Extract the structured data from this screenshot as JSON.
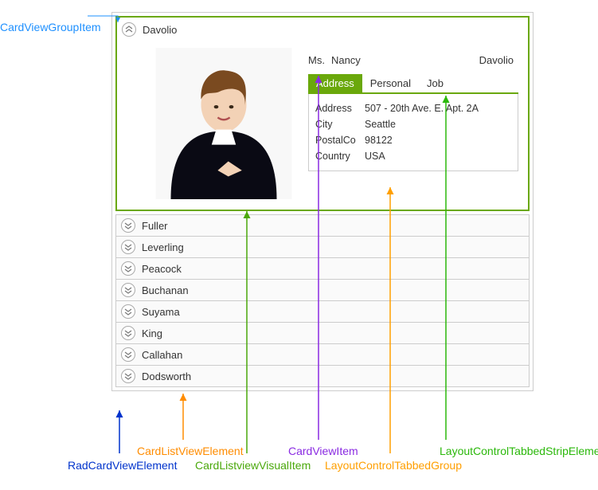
{
  "callouts": {
    "top_left": "CardViewGroupItem",
    "bottom": {
      "rad": "RadCardViewElement",
      "cardlist": "CardListViewElement",
      "visual": "CardListviewVisualItem",
      "cardview": "CardViewItem",
      "tabbedgroup": "LayoutControlTabbedGroup",
      "tabbedstrip": "LayoutControlTabbedStripElement"
    }
  },
  "card": {
    "header": "Davolio",
    "title": "Ms.",
    "first": "Nancy",
    "last": "Davolio",
    "tabs": {
      "address": "Address",
      "personal": "Personal",
      "job": "Job"
    },
    "fields": {
      "address_k": "Address",
      "address_v": "507 - 20th Ave. E. Apt. 2A",
      "city_k": "City",
      "city_v": "Seattle",
      "postal_k": "PostalCo",
      "postal_v": "98122",
      "country_k": "Country",
      "country_v": "USA"
    }
  },
  "groups": {
    "g1": "Fuller",
    "g2": "Leverling",
    "g3": "Peacock",
    "g4": "Buchanan",
    "g5": "Suyama",
    "g6": "King",
    "g7": "Callahan",
    "g8": "Dodsworth"
  }
}
